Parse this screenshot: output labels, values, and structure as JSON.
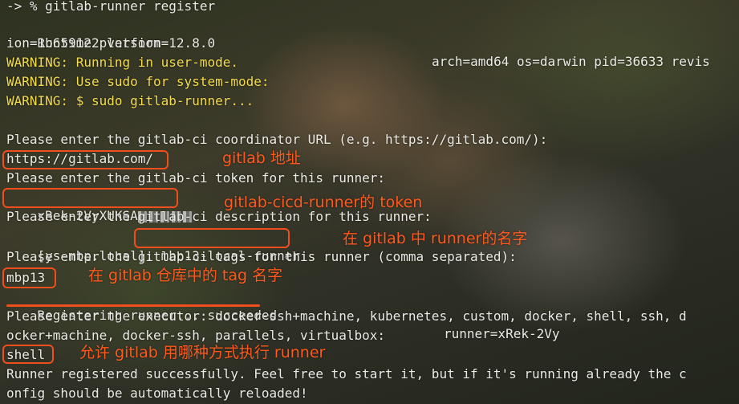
{
  "terminal": {
    "prompt": "-> % gitlab-runner register",
    "runtime_label": "Runtime platform",
    "runtime_right": "arch=amd64 os=darwin pid=36633 revis",
    "runtime_cont": "ion=1b659122 version=12.8.0",
    "warn1": "WARNING: Running in user-mode.",
    "warn2": "WARNING: Use sudo for system-mode:",
    "warn3": "WARNING: $ sudo gitlab-runner...",
    "q_url": "Please enter the gitlab-ci coordinator URL (e.g. https://gitlab.com/):",
    "a_url": "https://gitlab.com/",
    "q_token": "Please enter the gitlab-ci token for this runner:",
    "a_token": "xRek-2VyXUKSA",
    "q_desc": "Please enter the gitlab-ci description for this runner:",
    "desc_default": "[ys-mbp.local]: ",
    "a_desc": "mbp13-local-runner",
    "q_tags": "Please enter the gitlab-ci tags for this runner (comma separated):",
    "a_tags": "mbp13",
    "registering": "Registering runner... succeeded",
    "registering_right": "runner=xRek-2Vy",
    "q_executor": "Please enter the executor: docker-ssh+machine, kubernetes, custom, docker, shell, ssh, d",
    "q_executor_cont": "ocker+machine, docker-ssh, parallels, virtualbox:",
    "a_executor": "shell",
    "success1": "Runner registered successfully. Feel free to start it, but if it's running already the c",
    "success2": "onfig should be automatically reloaded!"
  },
  "annotations": {
    "url_note": "gitlab 地址",
    "token_note": "gitlab-cicd-runner的 token",
    "desc_note": "在 gitlab 中 runner的名字",
    "tags_note": "在 gitlab 仓库中的 tag 名字",
    "executor_note": "允许 gitlab 用哪种方式执行 runner"
  },
  "colors": {
    "warning": "#f4dc4c",
    "annotation": "#ff5a1e",
    "text": "#ecebe6"
  }
}
